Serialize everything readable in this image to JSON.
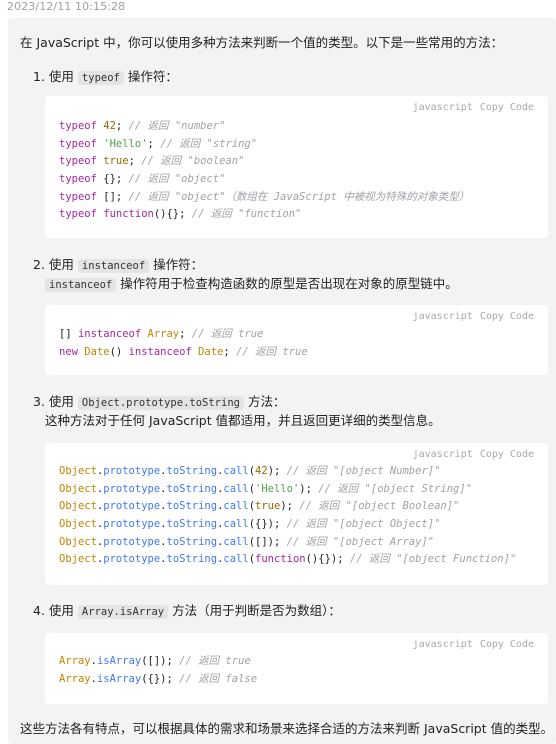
{
  "timestamp": "2023/12/11 10:15:28",
  "intro": "在 JavaScript 中，你可以使用多种方法来判断一个值的类型。以下是一些常用的方法：",
  "code_meta": {
    "language": "javascript",
    "copy_label": "Copy Code"
  },
  "items": [
    {
      "number": "1.",
      "prefix": "使用",
      "code": "typeof",
      "suffix": "操作符：",
      "code_lines": [
        [
          [
            "kw",
            "typeof"
          ],
          [
            "p",
            " "
          ],
          [
            "num",
            "42"
          ],
          [
            "p",
            "; "
          ],
          [
            "cm",
            "// 返回 \"number\""
          ]
        ],
        [
          [
            "kw",
            "typeof"
          ],
          [
            "p",
            " "
          ],
          [
            "str",
            "'Hello'"
          ],
          [
            "p",
            "; "
          ],
          [
            "cm",
            "// 返回 \"string\""
          ]
        ],
        [
          [
            "kw",
            "typeof"
          ],
          [
            "p",
            " "
          ],
          [
            "num",
            "true"
          ],
          [
            "p",
            "; "
          ],
          [
            "cm",
            "// 返回 \"boolean\""
          ]
        ],
        [
          [
            "kw",
            "typeof"
          ],
          [
            "p",
            " {}; "
          ],
          [
            "cm",
            "// 返回 \"object\""
          ]
        ],
        [
          [
            "kw",
            "typeof"
          ],
          [
            "p",
            " []; "
          ],
          [
            "cm",
            "// 返回 \"object\"（数组在 JavaScript 中被视为特殊的对象类型）"
          ]
        ],
        [
          [
            "kw",
            "typeof"
          ],
          [
            "p",
            " "
          ],
          [
            "kw",
            "function"
          ],
          [
            "p",
            "(){}; "
          ],
          [
            "cm",
            "// 返回 \"function\""
          ]
        ]
      ]
    },
    {
      "number": "2.",
      "prefix": "使用",
      "code": "instanceof",
      "suffix": "操作符：",
      "sub_code": "instanceof",
      "sub_text": "操作符用于检查构造函数的原型是否出现在对象的原型链中。",
      "code_lines": [
        [
          [
            "p",
            "[] "
          ],
          [
            "kw",
            "instanceof"
          ],
          [
            "p",
            " "
          ],
          [
            "cls",
            "Array"
          ],
          [
            "p",
            "; "
          ],
          [
            "cm",
            "// 返回 true"
          ]
        ],
        [
          [
            "kw",
            "new"
          ],
          [
            "p",
            " "
          ],
          [
            "cls",
            "Date"
          ],
          [
            "p",
            "() "
          ],
          [
            "kw",
            "instanceof"
          ],
          [
            "p",
            " "
          ],
          [
            "cls",
            "Date"
          ],
          [
            "p",
            "; "
          ],
          [
            "cm",
            "// 返回 true"
          ]
        ]
      ]
    },
    {
      "number": "3.",
      "prefix": "使用",
      "code": "Object.prototype.toString",
      "suffix": "方法：",
      "sub_text": "这种方法对于任何 JavaScript 值都适用，并且返回更详细的类型信息。",
      "code_lines": [
        [
          [
            "cls",
            "Object"
          ],
          [
            "p",
            "."
          ],
          [
            "fn",
            "prototype"
          ],
          [
            "p",
            "."
          ],
          [
            "fn",
            "toString"
          ],
          [
            "p",
            "."
          ],
          [
            "fn",
            "call"
          ],
          [
            "p",
            "("
          ],
          [
            "num",
            "42"
          ],
          [
            "p",
            "); "
          ],
          [
            "cm",
            "// 返回 \"[object Number]\""
          ]
        ],
        [
          [
            "cls",
            "Object"
          ],
          [
            "p",
            "."
          ],
          [
            "fn",
            "prototype"
          ],
          [
            "p",
            "."
          ],
          [
            "fn",
            "toString"
          ],
          [
            "p",
            "."
          ],
          [
            "fn",
            "call"
          ],
          [
            "p",
            "("
          ],
          [
            "str",
            "'Hello'"
          ],
          [
            "p",
            "); "
          ],
          [
            "cm",
            "// 返回 \"[object String]\""
          ]
        ],
        [
          [
            "cls",
            "Object"
          ],
          [
            "p",
            "."
          ],
          [
            "fn",
            "prototype"
          ],
          [
            "p",
            "."
          ],
          [
            "fn",
            "toString"
          ],
          [
            "p",
            "."
          ],
          [
            "fn",
            "call"
          ],
          [
            "p",
            "("
          ],
          [
            "num",
            "true"
          ],
          [
            "p",
            "); "
          ],
          [
            "cm",
            "// 返回 \"[object Boolean]\""
          ]
        ],
        [
          [
            "cls",
            "Object"
          ],
          [
            "p",
            "."
          ],
          [
            "fn",
            "prototype"
          ],
          [
            "p",
            "."
          ],
          [
            "fn",
            "toString"
          ],
          [
            "p",
            "."
          ],
          [
            "fn",
            "call"
          ],
          [
            "p",
            "({}); "
          ],
          [
            "cm",
            "// 返回 \"[object Object]\""
          ]
        ],
        [
          [
            "cls",
            "Object"
          ],
          [
            "p",
            "."
          ],
          [
            "fn",
            "prototype"
          ],
          [
            "p",
            "."
          ],
          [
            "fn",
            "toString"
          ],
          [
            "p",
            "."
          ],
          [
            "fn",
            "call"
          ],
          [
            "p",
            "([]); "
          ],
          [
            "cm",
            "// 返回 \"[object Array]\""
          ]
        ],
        [
          [
            "cls",
            "Object"
          ],
          [
            "p",
            "."
          ],
          [
            "fn",
            "prototype"
          ],
          [
            "p",
            "."
          ],
          [
            "fn",
            "toString"
          ],
          [
            "p",
            "."
          ],
          [
            "fn",
            "call"
          ],
          [
            "p",
            "("
          ],
          [
            "kw",
            "function"
          ],
          [
            "p",
            "(){}); "
          ],
          [
            "cm",
            "// 返回 \"[object Function]\""
          ]
        ]
      ]
    },
    {
      "number": "4.",
      "prefix": "使用",
      "code": "Array.isArray",
      "suffix": "方法（用于判断是否为数组）：",
      "code_lines": [
        [
          [
            "cls",
            "Array"
          ],
          [
            "p",
            "."
          ],
          [
            "fn",
            "isArray"
          ],
          [
            "p",
            "([]); "
          ],
          [
            "cm",
            "// 返回 true"
          ]
        ],
        [
          [
            "cls",
            "Array"
          ],
          [
            "p",
            "."
          ],
          [
            "fn",
            "isArray"
          ],
          [
            "p",
            "({}); "
          ],
          [
            "cm",
            "// 返回 false"
          ]
        ]
      ]
    }
  ],
  "outro": "这些方法各有特点，可以根据具体的需求和场景来选择合适的方法来判断 JavaScript 值的类型。"
}
